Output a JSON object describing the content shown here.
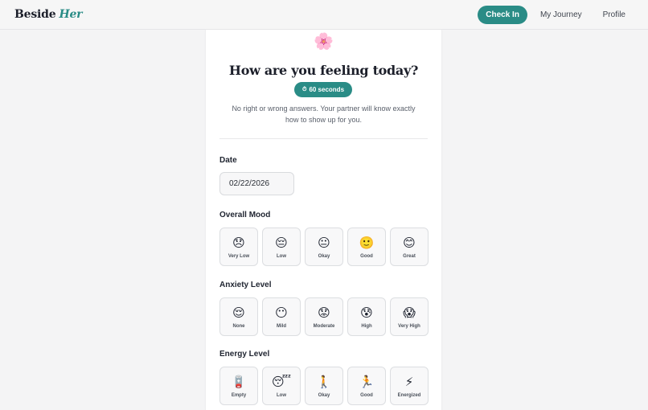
{
  "brand": {
    "name": "Beside",
    "accent": "Her"
  },
  "nav": {
    "check_in": "Check In",
    "my_journey": "My Journey",
    "profile": "Profile"
  },
  "card": {
    "flower_emoji": "🌸",
    "title": "How are you feeling today?",
    "timer": {
      "icon": "⏱",
      "label": "60 seconds"
    },
    "subtitle": "No right or wrong answers. Your partner will know exactly how to show up for you."
  },
  "date": {
    "label": "Date",
    "value": "02/22/2026"
  },
  "mood": {
    "label": "Overall Mood",
    "options": [
      {
        "emoji": "😞",
        "label": "Very Low"
      },
      {
        "emoji": "😔",
        "label": "Low"
      },
      {
        "emoji": "😐",
        "label": "Okay"
      },
      {
        "emoji": "🙂",
        "label": "Good"
      },
      {
        "emoji": "😊",
        "label": "Great"
      }
    ]
  },
  "anxiety": {
    "label": "Anxiety Level",
    "options": [
      {
        "emoji": "😌",
        "label": "None"
      },
      {
        "emoji": "😶",
        "label": "Mild"
      },
      {
        "emoji": "😟",
        "label": "Moderate"
      },
      {
        "emoji": "😰",
        "label": "High"
      },
      {
        "emoji": "😱",
        "label": "Very High"
      }
    ]
  },
  "energy": {
    "label": "Energy Level",
    "options": [
      {
        "emoji": "🪫",
        "label": "Empty"
      },
      {
        "emoji": "😴",
        "label": "Low"
      },
      {
        "emoji": "🚶",
        "label": "Okay"
      },
      {
        "emoji": "🏃",
        "label": "Good"
      },
      {
        "emoji": "⚡",
        "label": "Energized"
      }
    ]
  },
  "colors": {
    "accent": "#2a8c86",
    "background": "#f4f4f5",
    "card": "#ffffff"
  }
}
